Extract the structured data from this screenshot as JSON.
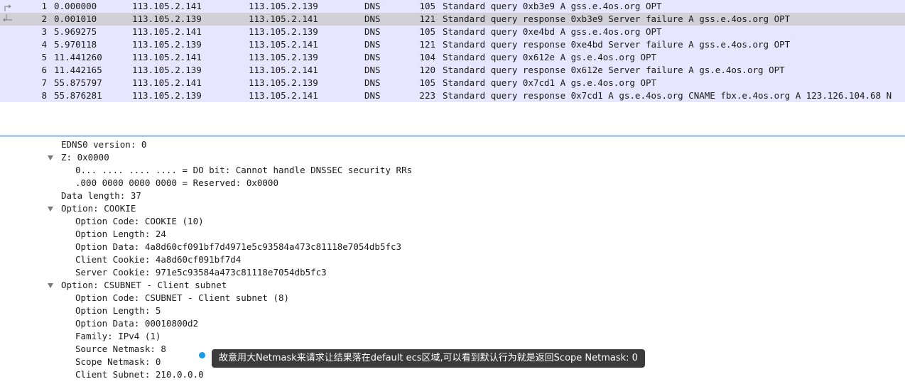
{
  "packets": [
    {
      "no": "1",
      "time": "0.000000",
      "src": "113.105.2.141",
      "dst": "113.105.2.139",
      "proto": "DNS",
      "len": "105",
      "info": "Standard query 0xb3e9 A gss.e.4os.org OPT"
    },
    {
      "no": "2",
      "time": "0.001010",
      "src": "113.105.2.139",
      "dst": "113.105.2.141",
      "proto": "DNS",
      "len": "121",
      "info": "Standard query response 0xb3e9 Server failure A gss.e.4os.org OPT"
    },
    {
      "no": "3",
      "time": "5.969275",
      "src": "113.105.2.141",
      "dst": "113.105.2.139",
      "proto": "DNS",
      "len": "105",
      "info": "Standard query 0xe4bd A gss.e.4os.org OPT"
    },
    {
      "no": "4",
      "time": "5.970118",
      "src": "113.105.2.139",
      "dst": "113.105.2.141",
      "proto": "DNS",
      "len": "121",
      "info": "Standard query response 0xe4bd Server failure A gss.e.4os.org OPT"
    },
    {
      "no": "5",
      "time": "11.441260",
      "src": "113.105.2.141",
      "dst": "113.105.2.139",
      "proto": "DNS",
      "len": "104",
      "info": "Standard query 0x612e A gs.e.4os.org OPT"
    },
    {
      "no": "6",
      "time": "11.442165",
      "src": "113.105.2.139",
      "dst": "113.105.2.141",
      "proto": "DNS",
      "len": "120",
      "info": "Standard query response 0x612e Server failure A gs.e.4os.org OPT"
    },
    {
      "no": "7",
      "time": "55.875797",
      "src": "113.105.2.141",
      "dst": "113.105.2.139",
      "proto": "DNS",
      "len": "105",
      "info": "Standard query 0x7cd1 A gs.e.4os.org OPT"
    },
    {
      "no": "8",
      "time": "55.876281",
      "src": "113.105.2.139",
      "dst": "113.105.2.141",
      "proto": "DNS",
      "len": "223",
      "info": "Standard query response 0x7cd1 A gs.e.4os.org CNAME fbx.e.4os.org A 123.126.104.68 N"
    }
  ],
  "selected_packet": "2",
  "details": [
    {
      "text": "EDNS0 version: 0",
      "level": 1,
      "expander": false
    },
    {
      "text": "Z: 0x0000",
      "level": 1,
      "expander": true
    },
    {
      "text": "0... .... .... .... = DO bit: Cannot handle DNSSEC security RRs",
      "level": 2,
      "expander": false
    },
    {
      "text": ".000 0000 0000 0000 = Reserved: 0x0000",
      "level": 2,
      "expander": false
    },
    {
      "text": "Data length: 37",
      "level": 1,
      "expander": false
    },
    {
      "text": "Option: COOKIE",
      "level": 1,
      "expander": true
    },
    {
      "text": "Option Code: COOKIE (10)",
      "level": 2,
      "expander": false
    },
    {
      "text": "Option Length: 24",
      "level": 2,
      "expander": false
    },
    {
      "text": "Option Data: 4a8d60cf091bf7d4971e5c93584a473c81118e7054db5fc3",
      "level": 2,
      "expander": false
    },
    {
      "text": "Client Cookie: 4a8d60cf091bf7d4",
      "level": 2,
      "expander": false
    },
    {
      "text": "Server Cookie: 971e5c93584a473c81118e7054db5fc3",
      "level": 2,
      "expander": false
    },
    {
      "text": "Option: CSUBNET - Client subnet",
      "level": 1,
      "expander": true
    },
    {
      "text": "Option Code: CSUBNET - Client subnet (8)",
      "level": 2,
      "expander": false
    },
    {
      "text": "Option Length: 5",
      "level": 2,
      "expander": false
    },
    {
      "text": "Option Data: 00010800d2",
      "level": 2,
      "expander": false
    },
    {
      "text": "Family: IPv4 (1)",
      "level": 2,
      "expander": false
    },
    {
      "text": "Source Netmask: 8",
      "level": 2,
      "expander": false
    },
    {
      "text": "Scope Netmask: 0",
      "level": 2,
      "expander": false
    },
    {
      "text": "Client Subnet: 210.0.0.0",
      "level": 2,
      "expander": false
    }
  ],
  "annotation": "故意用大Netmask来请求让结果落在default ecs区域,可以看到默认行为就是返回Scope Netmask: 0",
  "colors": {
    "dns_row": "#e7e6ff",
    "selected_row": "#d0d0d6",
    "note_bg": "#3b3b3b",
    "note_dot": "#1a9be6"
  }
}
